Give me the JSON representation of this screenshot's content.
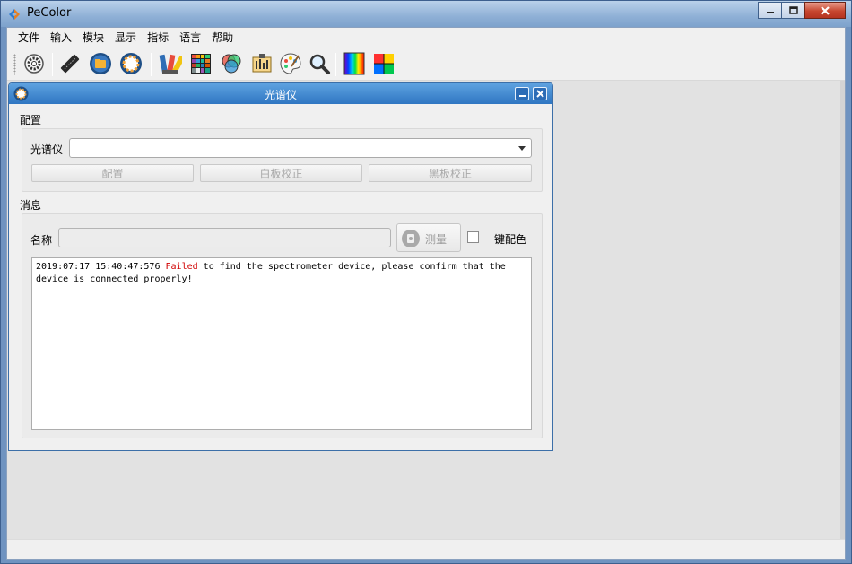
{
  "app": {
    "title": "PeColor"
  },
  "menu": [
    "文件",
    "输入",
    "模块",
    "显示",
    "指标",
    "语言",
    "帮助"
  ],
  "toolbar": {
    "icons": [
      "settings-gear-icon",
      "measuring-device-icon",
      "open-folder-icon",
      "spectrometer-icon",
      "color-fan-icon",
      "color-grid-icon",
      "rgb-circles-icon",
      "calibration-icon",
      "palette-icon",
      "magnifier-icon",
      "spectrum-icon",
      "color-square-icon"
    ]
  },
  "spectrometer_window": {
    "title": "光谱仪",
    "config_section": "配置",
    "spectrometer_label": "光谱仪",
    "spectrometer_value": "",
    "buttons": {
      "configure": "配置",
      "white_calibration": "白板校正",
      "black_calibration": "黑板校正"
    },
    "message_section": "消息",
    "name_label": "名称",
    "name_value": "",
    "measure_button": "测量",
    "one_click_label": "一键配色",
    "one_click_checked": false,
    "log": {
      "timestamp": "2019:07:17 15:40:47:576",
      "status": "Failed",
      "message": "to find the spectrometer device, please confirm that the device is connected properly!"
    }
  },
  "colors": {
    "title_active": "#2f76c2",
    "failed_text": "#d00000"
  }
}
